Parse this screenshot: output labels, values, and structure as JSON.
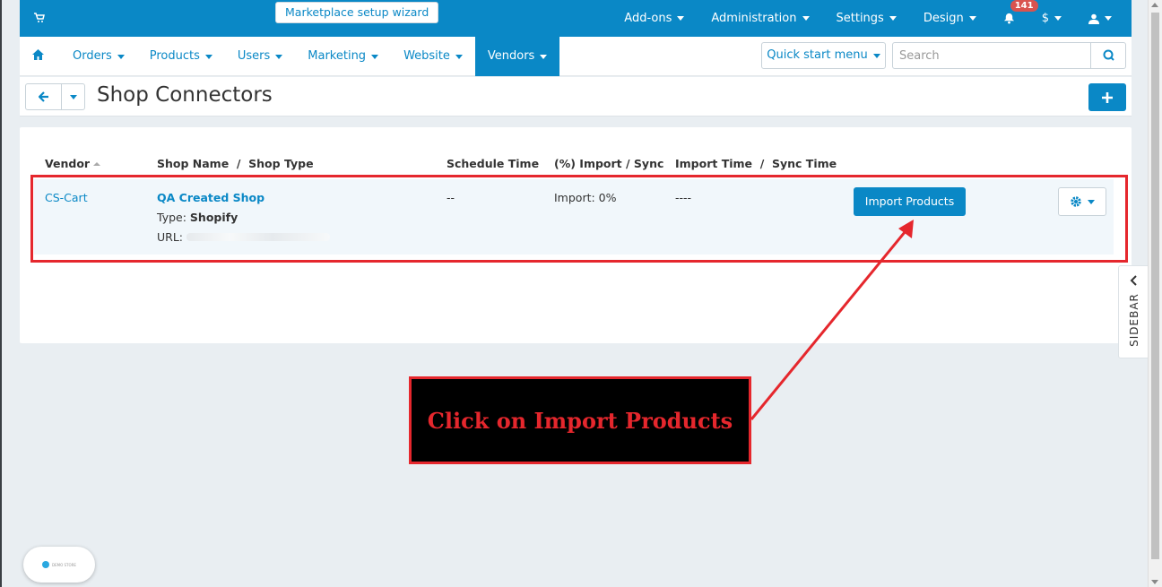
{
  "topbar": {
    "wizard_label": "Marketplace setup wizard",
    "menu": [
      {
        "label": "Add-ons"
      },
      {
        "label": "Administration"
      },
      {
        "label": "Settings"
      },
      {
        "label": "Design"
      }
    ],
    "notifications_count": "141",
    "currency": "$"
  },
  "navbar": {
    "items": [
      {
        "label": "Orders"
      },
      {
        "label": "Products"
      },
      {
        "label": "Users"
      },
      {
        "label": "Marketing"
      },
      {
        "label": "Website"
      },
      {
        "label": "Vendors"
      }
    ],
    "quick_start": "Quick start menu",
    "search_placeholder": "Search"
  },
  "page": {
    "title": "Shop Connectors"
  },
  "table": {
    "headers": {
      "vendor": "Vendor",
      "shop": "Shop Name  /  Shop Type",
      "schedule": "Schedule Time",
      "import_sync": "(%) Import / Sync",
      "times": "Import Time  /  Sync Time"
    },
    "rows": [
      {
        "vendor": "CS-Cart",
        "shop_name": "QA Created Shop",
        "type_label": "Type:",
        "type_value": "Shopify",
        "url_label": "URL:",
        "schedule": "--",
        "import_status": "Import: 0%",
        "times": "----",
        "action_label": "Import Products"
      }
    ]
  },
  "sidebar_label": "SIDEBAR",
  "callout_text": "Click on Import Products",
  "colors": {
    "accent": "#0a88c6",
    "annotation": "#e5272d"
  }
}
